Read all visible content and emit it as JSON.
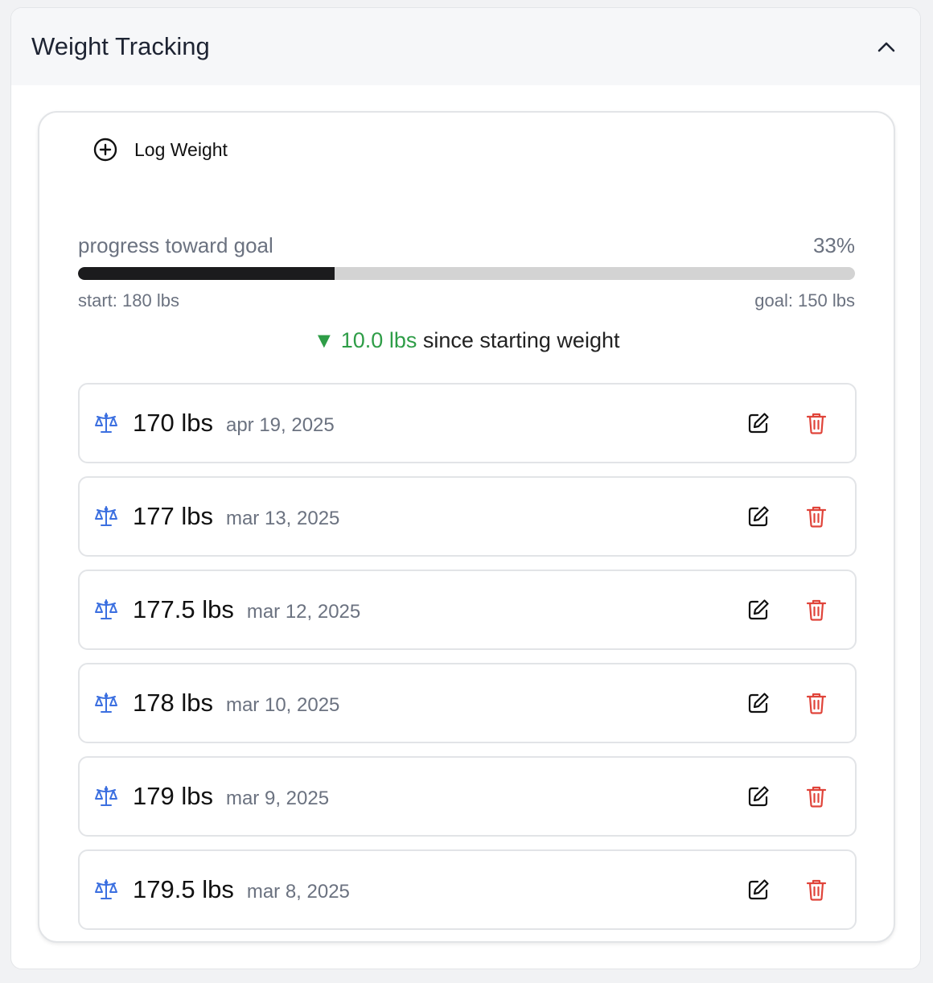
{
  "header": {
    "title": "Weight Tracking",
    "collapse_icon": "chevron-up-icon"
  },
  "log_button": {
    "label": "Log Weight",
    "icon": "plus-circle-icon"
  },
  "progress": {
    "label": "progress toward goal",
    "percent_text": "33%",
    "percent_value": 33,
    "start_label": "start: 180 lbs",
    "goal_label": "goal: 150 lbs",
    "fill_color": "#1b1b1d",
    "track_color": "#d3d3d3"
  },
  "change": {
    "arrow": "▼",
    "amount": "10.0 lbs",
    "text": "since starting weight",
    "color": "#2e9d47"
  },
  "entries": [
    {
      "weight": "170 lbs",
      "date": "apr 19, 2025"
    },
    {
      "weight": "177 lbs",
      "date": "mar 13, 2025"
    },
    {
      "weight": "177.5 lbs",
      "date": "mar 12, 2025"
    },
    {
      "weight": "178 lbs",
      "date": "mar 10, 2025"
    },
    {
      "weight": "179 lbs",
      "date": "mar 9, 2025"
    },
    {
      "weight": "179.5 lbs",
      "date": "mar 8, 2025"
    }
  ],
  "icons": {
    "entry": "scale-icon",
    "edit": "edit-icon",
    "delete": "trash-icon"
  },
  "colors": {
    "scale_icon": "#3b6fe0",
    "delete_icon": "#e0443a"
  }
}
